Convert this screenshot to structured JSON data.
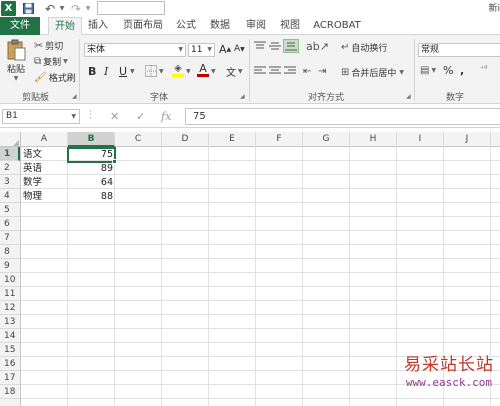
{
  "title_bar": {
    "app_logo": "X",
    "title": "新i",
    "save_icon": "save-icon",
    "undo_icon": "undo-icon",
    "redo_icon": "redo-icon"
  },
  "tabs": [
    {
      "label": "文件"
    },
    {
      "label": "开始"
    },
    {
      "label": "插入"
    },
    {
      "label": "页面布局"
    },
    {
      "label": "公式"
    },
    {
      "label": "数据"
    },
    {
      "label": "审阅"
    },
    {
      "label": "视图"
    },
    {
      "label": "ACROBAT"
    }
  ],
  "ribbon": {
    "clipboard": {
      "paste_label": "粘贴",
      "cut_label": "剪切",
      "copy_label": "复制",
      "format_painter_label": "格式刷",
      "group_label": "剪贴板"
    },
    "font": {
      "font_name": "宋体",
      "font_size": "11",
      "grow_label": "A",
      "shrink_label": "A",
      "bold": "B",
      "italic": "I",
      "underline": "U",
      "font_color_label": "A",
      "wen_label": "文",
      "group_label": "字体",
      "font_color": "#c00000",
      "fill_color": "#ffff00"
    },
    "alignment": {
      "wrap_label": "自动换行",
      "merge_label": "合并后居中",
      "group_label": "对齐方式"
    },
    "number": {
      "format": "常规",
      "percent": "%",
      "comma": ",",
      "group_label": "数字"
    }
  },
  "formula_bar": {
    "name_box": "B1",
    "fx_label": "fx",
    "value": "75"
  },
  "columns": [
    "A",
    "B",
    "C",
    "D",
    "E",
    "F",
    "G",
    "H",
    "I",
    "J"
  ],
  "rows": [
    "1",
    "2",
    "3",
    "4",
    "5",
    "6",
    "7",
    "8",
    "9",
    "10",
    "11",
    "12",
    "13",
    "14",
    "15",
    "16",
    "17",
    "18"
  ],
  "data": [
    {
      "subject": "语文",
      "score": "75"
    },
    {
      "subject": "英语",
      "score": "89"
    },
    {
      "subject": "数学",
      "score": "64"
    },
    {
      "subject": "物理",
      "score": "88"
    }
  ],
  "active_cell": "B1",
  "accent_color": "#217346",
  "watermark": {
    "text": "易采站长站",
    "url": "www.easck.com"
  }
}
